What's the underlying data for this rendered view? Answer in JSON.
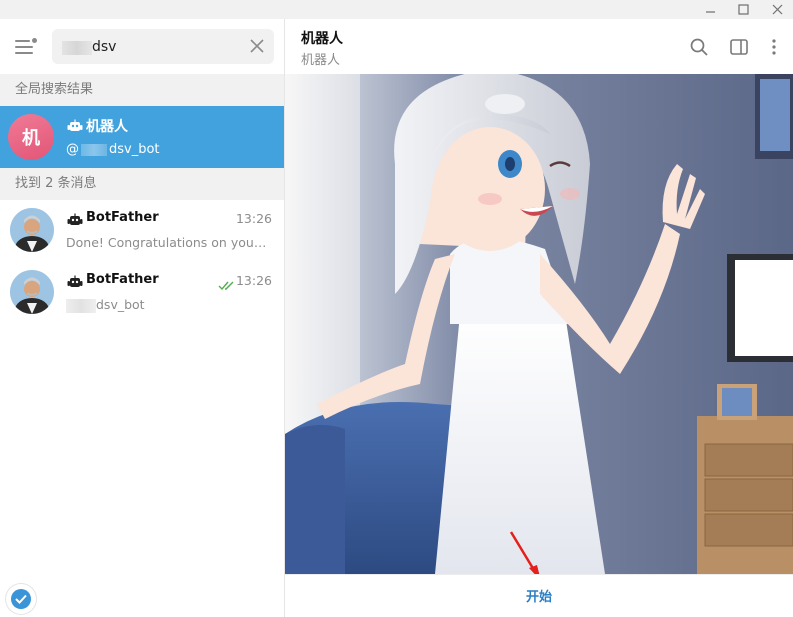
{
  "window": {
    "minimize_icon": "minimize-icon",
    "maximize_icon": "maximize-icon",
    "close_icon": "close-icon"
  },
  "sidebar": {
    "search": {
      "value": "dsv",
      "placeholder": ""
    },
    "global_results_header": "全局搜索结果",
    "global_result": {
      "avatar_letter": "机",
      "name": "机器人",
      "username_prefix": "@",
      "username_suffix": "dsv_bot"
    },
    "messages_header": "找到 2 条消息",
    "messages": [
      {
        "name": "BotFather",
        "time": "13:26",
        "preview": "Done! Congratulations on your new bot. You will find it at",
        "read": false
      },
      {
        "name": "BotFather",
        "time": "13:26",
        "preview": "dsv_bot",
        "read": true
      }
    ]
  },
  "chat": {
    "title": "机器人",
    "subtitle": "机器人",
    "start_button": "开始"
  },
  "colors": {
    "accent": "#41a2de",
    "link": "#2a7fc4",
    "read_check": "#4fae4e",
    "avatar_pink": "#e35577"
  }
}
